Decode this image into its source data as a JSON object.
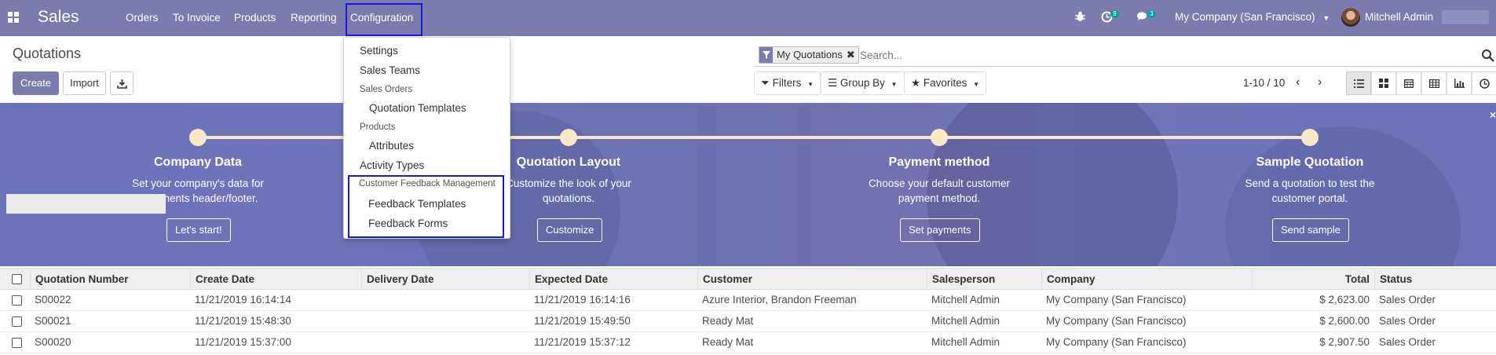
{
  "navbar": {
    "brand": "Sales",
    "menu": [
      "Orders",
      "To Invoice",
      "Products",
      "Reporting",
      "Configuration"
    ],
    "activity_count": "9",
    "message_count": "3",
    "company": "My Company (San Francisco)",
    "user": "Mitchell Admin",
    "icons": {
      "apps": "apps-grid-icon",
      "bug": "bug-icon",
      "activity": "clock-icon",
      "messages": "chat-icon"
    }
  },
  "control_panel": {
    "breadcrumb": "Quotations",
    "create_label": "Create",
    "import_label": "Import",
    "facet_label": "My Quotations",
    "search_placeholder": "Search...",
    "filters_label": "Filters",
    "groupby_label": "Group By",
    "favorites_label": "Favorites",
    "pager": "1-10 / 10",
    "views": [
      "list-view-icon",
      "kanban-view-icon",
      "calendar-view-icon",
      "pivot-view-icon",
      "graph-view-icon",
      "activity-view-icon"
    ]
  },
  "configuration_menu": {
    "items": [
      {
        "type": "item",
        "label": "Settings"
      },
      {
        "type": "item",
        "label": "Sales Teams"
      },
      {
        "type": "header",
        "label": "Sales Orders"
      },
      {
        "type": "sub",
        "label": "Quotation Templates"
      },
      {
        "type": "header",
        "label": "Products"
      },
      {
        "type": "sub",
        "label": "Attributes"
      },
      {
        "type": "item",
        "label": "Activity Types"
      },
      {
        "type": "header",
        "label": "Customer Feedback Management"
      },
      {
        "type": "sub",
        "label": "Feedback Templates"
      },
      {
        "type": "sub",
        "label": "Feedback Forms"
      }
    ]
  },
  "banner": {
    "steps": [
      {
        "title": "Company Data",
        "desc": [
          "Set your company's data for",
          "documents header/footer."
        ],
        "button": "Let's start!"
      },
      {
        "title": "Quotation Layout",
        "desc": [
          "Customize the look of your",
          "quotations."
        ],
        "button": "Customize"
      },
      {
        "title": "Payment method",
        "desc": [
          "Choose your default customer",
          "payment method."
        ],
        "button": "Set payments"
      },
      {
        "title": "Sample Quotation",
        "desc": [
          "Send a quotation to test the",
          "customer portal."
        ],
        "button": "Send sample"
      }
    ],
    "close": "×"
  },
  "table": {
    "columns": [
      "Quotation Number",
      "Create Date",
      "Delivery Date",
      "Expected Date",
      "Customer",
      "Salesperson",
      "Company",
      "Total",
      "Status"
    ],
    "rows": [
      [
        "S00022",
        "11/21/2019 16:14:14",
        "",
        "11/21/2019 16:14:16",
        "Azure Interior, Brandon Freeman",
        "Mitchell Admin",
        "My Company (San Francisco)",
        "$ 2,623.00",
        "Sales Order"
      ],
      [
        "S00021",
        "11/21/2019 15:48:30",
        "",
        "11/21/2019 15:49:50",
        "Ready Mat",
        "Mitchell Admin",
        "My Company (San Francisco)",
        "$ 2,600.00",
        "Sales Order"
      ],
      [
        "S00020",
        "11/21/2019 15:37:00",
        "",
        "11/21/2019 15:37:12",
        "Ready Mat",
        "Mitchell Admin",
        "My Company (San Francisco)",
        "$ 2,907.50",
        "Sales Order"
      ]
    ]
  },
  "colors": {
    "brand": "#7c7bad",
    "highlight_box": "#1a1adb",
    "banner": "#6c71b4"
  }
}
